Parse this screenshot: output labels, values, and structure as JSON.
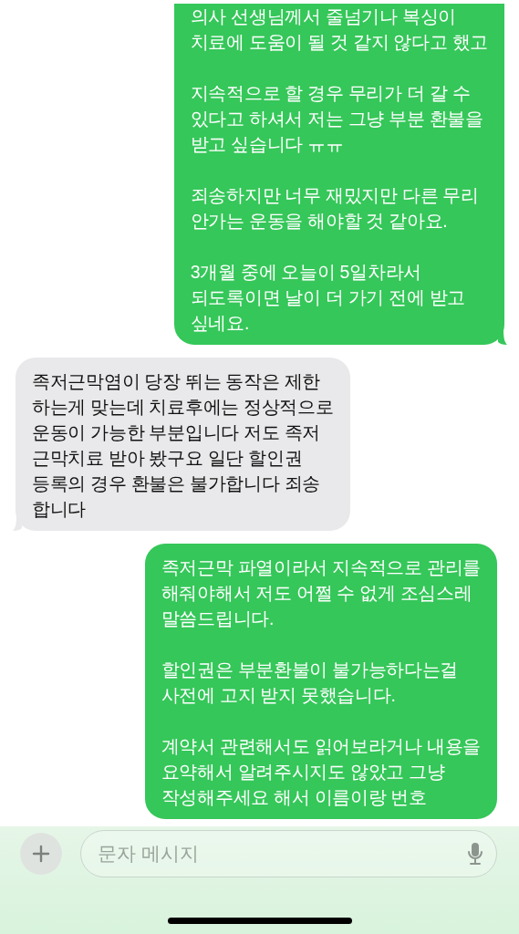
{
  "messages": [
    {
      "kind": "sent",
      "paragraphs": [
        "의사 선생님께서 줄넘기나 복싱이\n치료에 도움이 될 것 같지 않다고 했고",
        "지속적으로 할 경우 무리가 더 갈 수\n있다고 하셔서 저는 그냥 부분 환불을\n받고 싶습니다 ㅠㅠ",
        "죄송하지만 너무 재밌지만 다른 무리\n안가는 운동을 해야할 것 같아요.",
        "3개월 중에 오늘이 5일차라서\n되도록이면 날이 더 가기 전에 받고\n싶네요."
      ]
    },
    {
      "kind": "received",
      "paragraphs": [
        "족저근막염이 당장 뛰는 동작은 제한\n하는게 맞는데 치료후에는 정상적으로\n운동이 가능한 부분입니다 저도 족저\n근막치료 받아 봤구요 일단 할인권\n등록의 경우 환불은 불가합니다 죄송\n합니다"
      ]
    },
    {
      "kind": "sent",
      "paragraphs": [
        "족저근막 파열이라서 지속적으로 관리를\n해줘야해서 저도 어쩔 수 없게 조심스레\n말씀드립니다.",
        "할인권은 부분환불이 불가능하다는걸\n사전에 고지 받지 못했습니다.",
        "계약서 관련해서도 읽어보라거나 내용을\n요약해서 알려주시지도 않았고 그냥\n작성해주세요 해서 이름이랑 번호"
      ]
    }
  ],
  "composer": {
    "placeholder": "문자 메시지"
  }
}
